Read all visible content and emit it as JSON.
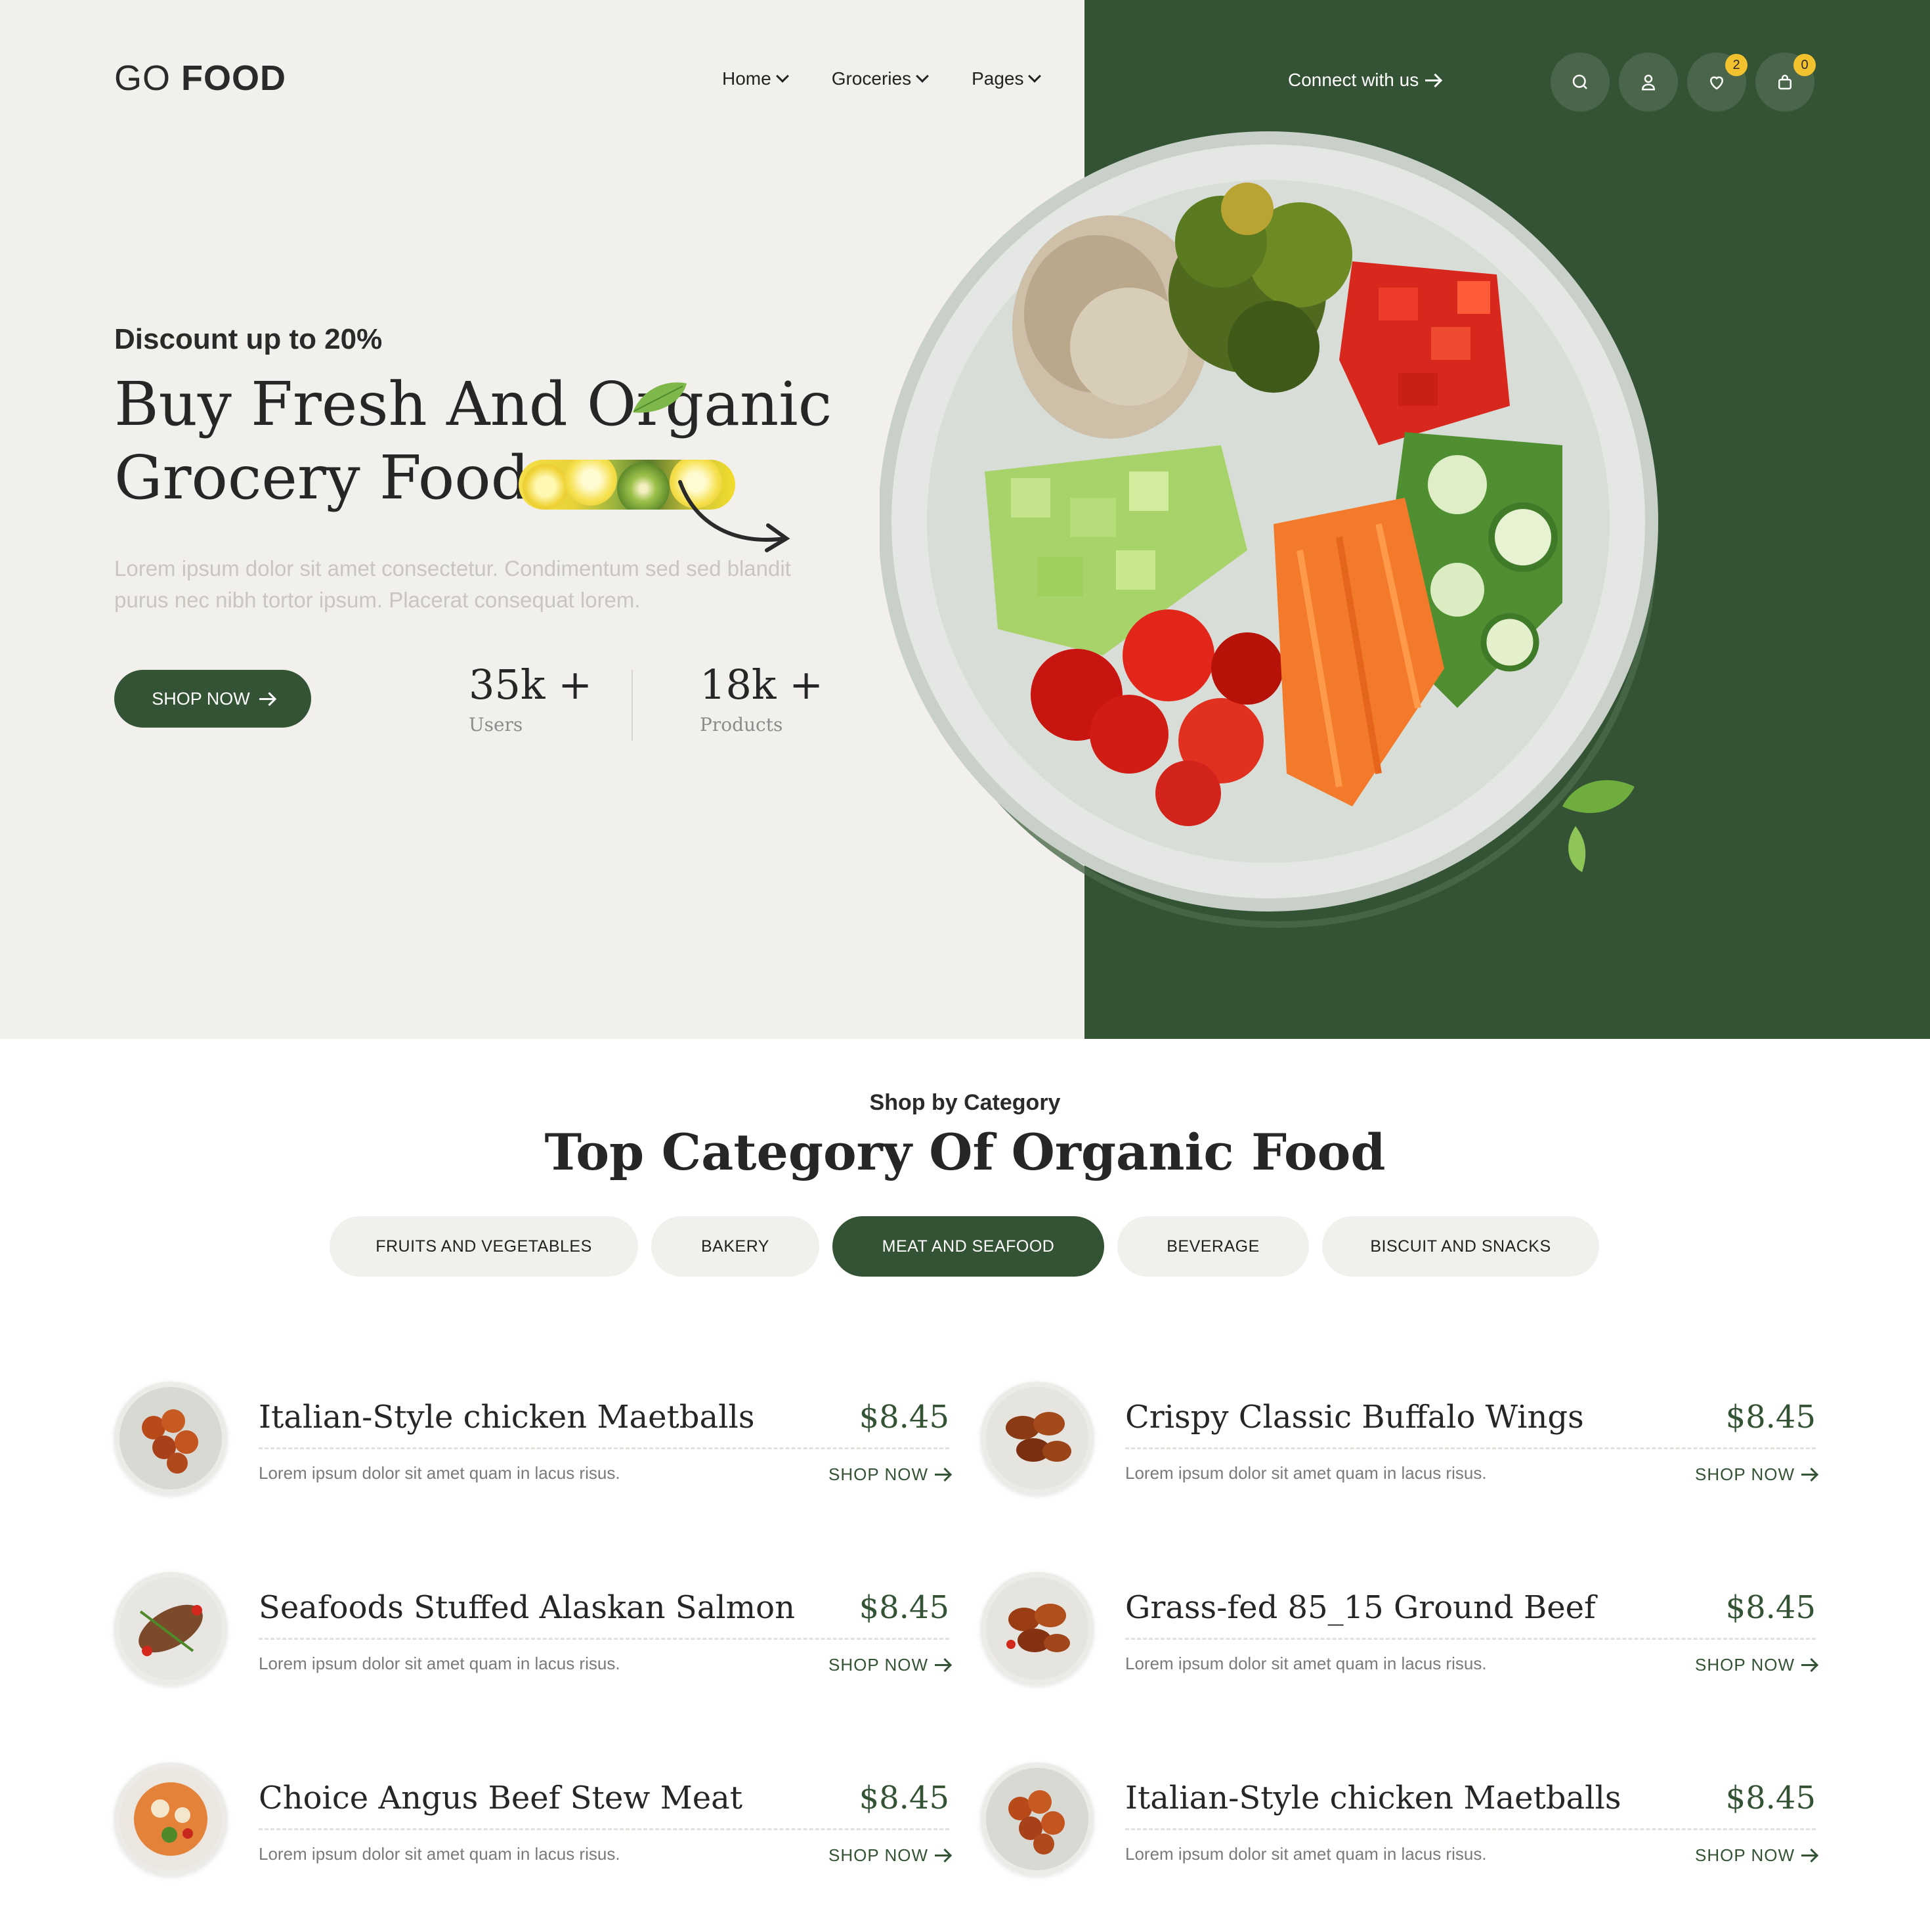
{
  "brand": {
    "logo_light": "GO",
    "logo_bold": "FOOD"
  },
  "nav": {
    "items": [
      {
        "label": "Home"
      },
      {
        "label": "Groceries"
      },
      {
        "label": "Pages"
      }
    ],
    "connect_label": "Connect with us",
    "icons": [
      "search-icon",
      "user-icon",
      "heart-icon",
      "bag-icon"
    ],
    "wishlist_count": "2",
    "cart_count": "0"
  },
  "hero": {
    "eyebrow": "Discount up to 20%",
    "title_line1": "Buy Fresh And Organic",
    "title_line2": "Grocery Food",
    "description": "Lorem ipsum dolor sit amet consectetur. Condimentum sed sed blandit purus nec nibh tortor ipsum. Placerat consequat lorem.",
    "cta_label": "SHOP NOW",
    "stats": [
      {
        "value": "35k +",
        "label": "Users"
      },
      {
        "value": "18k +",
        "label": "Products"
      }
    ]
  },
  "categories": {
    "eyebrow": "Shop by Category",
    "title": "Top Category Of Organic Food",
    "tabs": [
      {
        "label": "FRUITS AND VEGETABLES",
        "active": false
      },
      {
        "label": "BAKERY",
        "active": false
      },
      {
        "label": "MEAT AND SEAFOOD",
        "active": true
      },
      {
        "label": "BEVERAGE",
        "active": false
      },
      {
        "label": "BISCUIT AND SNACKS",
        "active": false
      }
    ]
  },
  "products": [
    {
      "name": "Italian-Style chicken Maetballs",
      "price": "$8.45",
      "description": "Lorem ipsum dolor sit amet quam in lacus risus.",
      "cta": "SHOP NOW"
    },
    {
      "name": "Crispy Classic Buffalo Wings",
      "price": "$8.45",
      "description": "Lorem ipsum dolor sit amet quam in lacus risus.",
      "cta": "SHOP NOW"
    },
    {
      "name": "Seafoods Stuffed Alaskan Salmon",
      "price": "$8.45",
      "description": "Lorem ipsum dolor sit amet quam in lacus risus.",
      "cta": "SHOP NOW"
    },
    {
      "name": "Grass-fed 85_15 Ground Beef",
      "price": "$8.45",
      "description": "Lorem ipsum dolor sit amet quam in lacus risus.",
      "cta": "SHOP NOW"
    },
    {
      "name": "Choice Angus Beef Stew Meat",
      "price": "$8.45",
      "description": "Lorem ipsum dolor sit amet quam in lacus risus.",
      "cta": "SHOP NOW"
    },
    {
      "name": "Italian-Style chicken Maetballs",
      "price": "$8.45",
      "description": "Lorem ipsum dolor sit amet quam in lacus risus.",
      "cta": "SHOP NOW"
    }
  ],
  "colors": {
    "primary_green": "#345234",
    "hero_bg": "#f2f0ec",
    "badge_yellow": "#f2c12e"
  }
}
